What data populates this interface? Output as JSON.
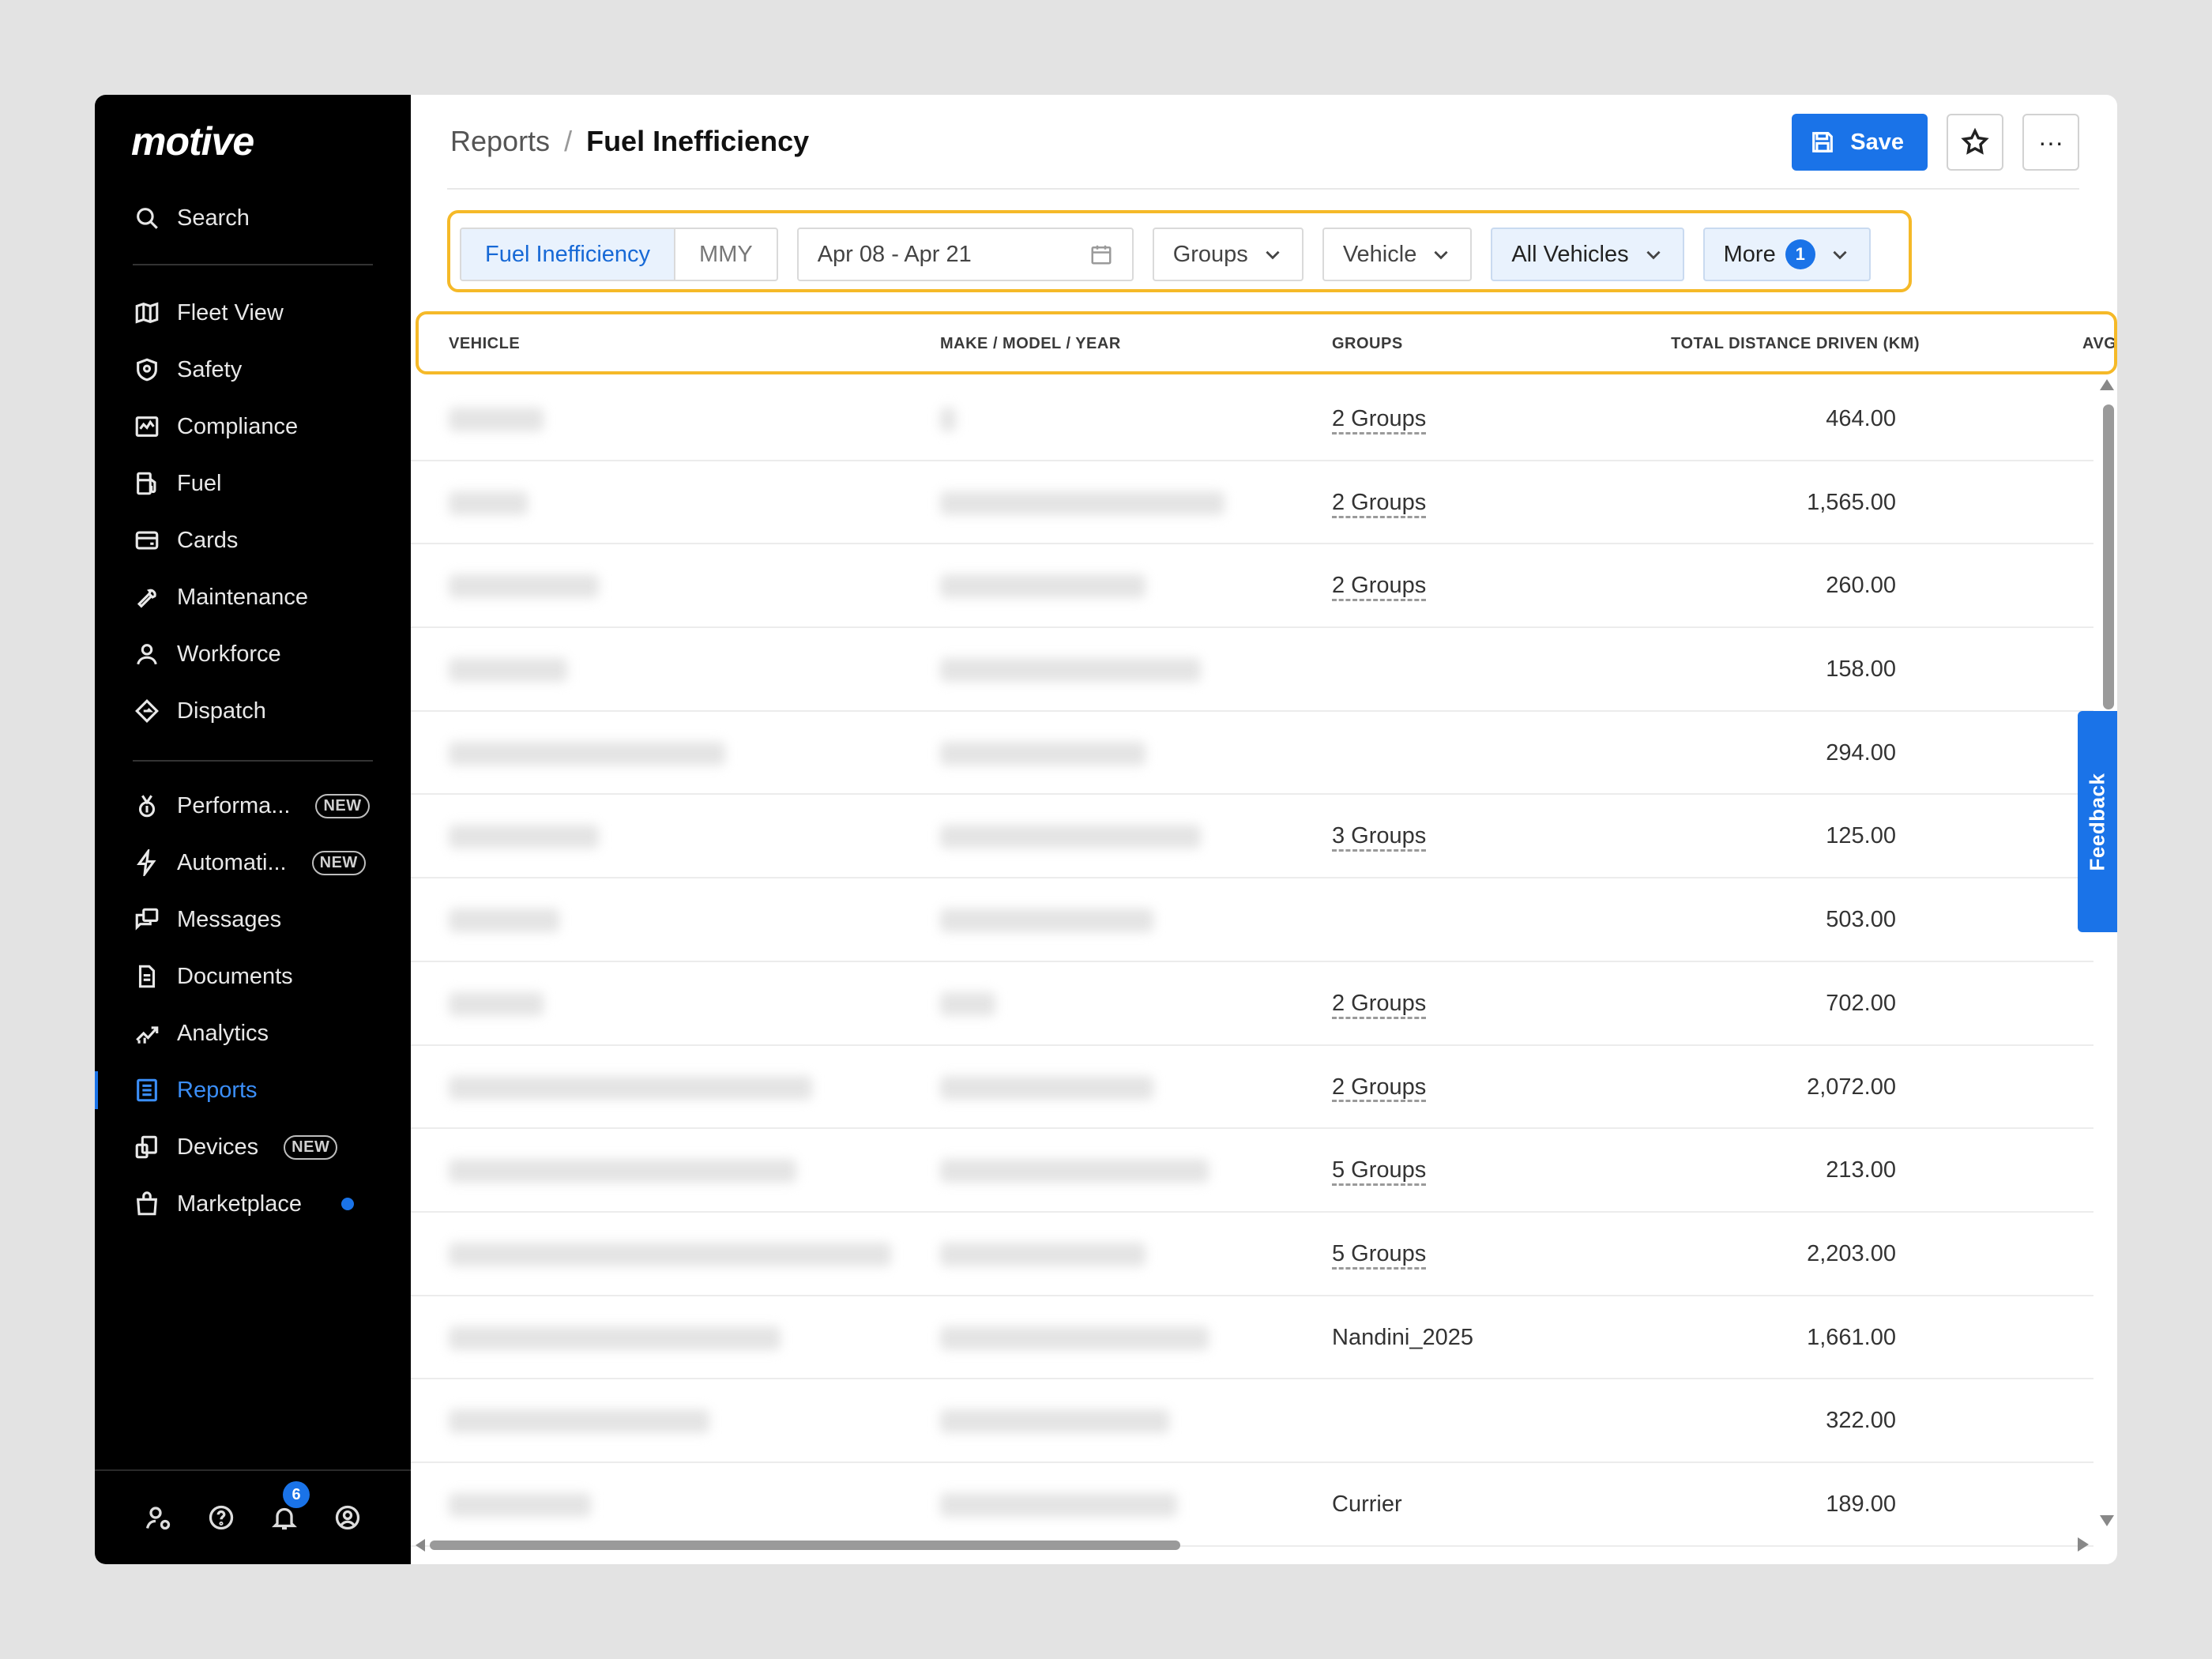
{
  "app": {
    "logo": "motive"
  },
  "sidebar": {
    "search_label": "Search",
    "primary": [
      {
        "label": "Fleet View",
        "icon": "map-icon"
      },
      {
        "label": "Safety",
        "icon": "shield-icon"
      },
      {
        "label": "Compliance",
        "icon": "compliance-icon"
      },
      {
        "label": "Fuel",
        "icon": "fuel-icon"
      },
      {
        "label": "Cards",
        "icon": "card-icon"
      },
      {
        "label": "Maintenance",
        "icon": "wrench-icon"
      },
      {
        "label": "Workforce",
        "icon": "person-icon"
      },
      {
        "label": "Dispatch",
        "icon": "dispatch-icon"
      }
    ],
    "secondary": [
      {
        "label": "Performa...",
        "icon": "medal-icon",
        "badge": "NEW"
      },
      {
        "label": "Automati...",
        "icon": "lightning-icon",
        "badge": "NEW"
      },
      {
        "label": "Messages",
        "icon": "messages-icon"
      },
      {
        "label": "Documents",
        "icon": "document-icon"
      },
      {
        "label": "Analytics",
        "icon": "analytics-icon"
      },
      {
        "label": "Reports",
        "icon": "reports-icon",
        "active": true
      },
      {
        "label": "Devices",
        "icon": "devices-icon",
        "badge": "NEW"
      },
      {
        "label": "Marketplace",
        "icon": "bag-icon",
        "dot": true
      }
    ],
    "notification_count": "6"
  },
  "header": {
    "breadcrumb_parent": "Reports",
    "breadcrumb_sep": "/",
    "title": "Fuel Inefficiency",
    "save_label": "Save",
    "more_label": "···"
  },
  "filters": {
    "segment": [
      "Fuel Inefficiency",
      "MMY"
    ],
    "date_range": "Apr 08 - Apr 21",
    "groups": "Groups",
    "vehicle": "Vehicle",
    "all_vehicles": "All Vehicles",
    "more": "More",
    "more_count": "1"
  },
  "table": {
    "columns": [
      "VEHICLE",
      "MAKE / MODEL / YEAR",
      "GROUPS",
      "TOTAL DISTANCE DRIVEN (KM)",
      "AVG FUEL ECO"
    ],
    "rows": [
      {
        "groups": "2 Groups",
        "distance": "464.00"
      },
      {
        "groups": "2 Groups",
        "distance": "1,565.00"
      },
      {
        "groups": "2 Groups",
        "distance": "260.00"
      },
      {
        "groups": "",
        "distance": "158.00"
      },
      {
        "groups": "",
        "distance": "294.00"
      },
      {
        "groups": "3 Groups",
        "distance": "125.00"
      },
      {
        "groups": "",
        "distance": "503.00"
      },
      {
        "groups": "2 Groups",
        "distance": "702.00"
      },
      {
        "groups": "2 Groups",
        "distance": "2,072.00"
      },
      {
        "groups": "5 Groups",
        "distance": "213.00"
      },
      {
        "groups": "5 Groups",
        "distance": "2,203.00"
      },
      {
        "groups": "Nandini_2025",
        "distance": "1,661.00"
      },
      {
        "groups": "",
        "distance": "322.00"
      },
      {
        "groups": "Currier",
        "distance": "189.00"
      }
    ]
  },
  "feedback_label": "Feedback",
  "colors": {
    "accent": "#1a73e8",
    "highlight": "#f5b928",
    "sidebar_bg": "#000000"
  }
}
